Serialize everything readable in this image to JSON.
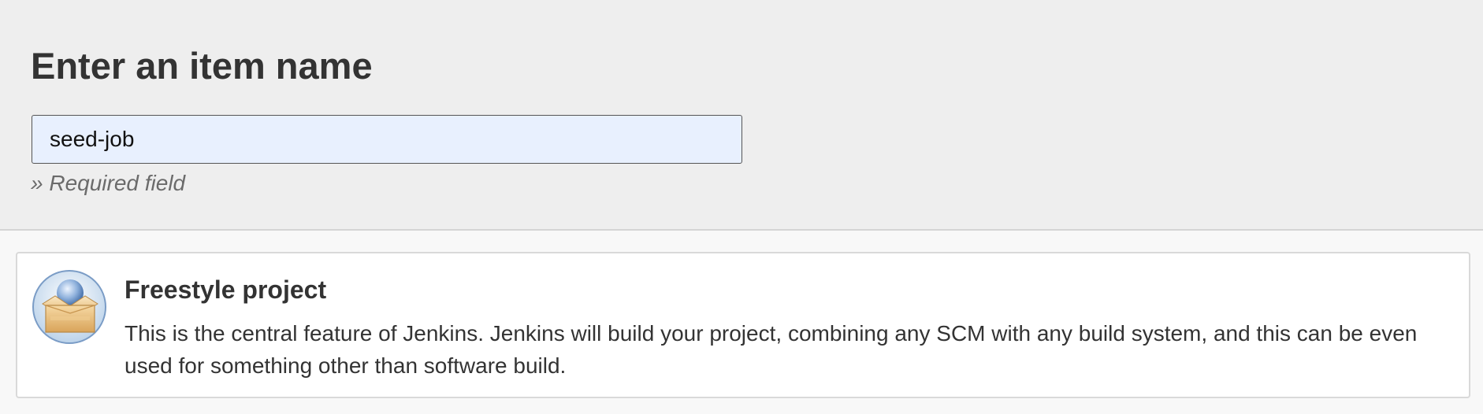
{
  "page": {
    "title": "Enter an item name"
  },
  "item_name": {
    "value": "seed-job",
    "required_hint": "» Required field"
  },
  "item_types": [
    {
      "title": "Freestyle project",
      "description": "This is the central feature of Jenkins. Jenkins will build your project, combining any SCM with any build system, and this can be even used for something other than software build.",
      "icon": "freestyle-project-icon"
    }
  ],
  "colors": {
    "input_background": "#e8f0fe",
    "header_background": "#eeeeee",
    "card_background": "#ffffff"
  }
}
